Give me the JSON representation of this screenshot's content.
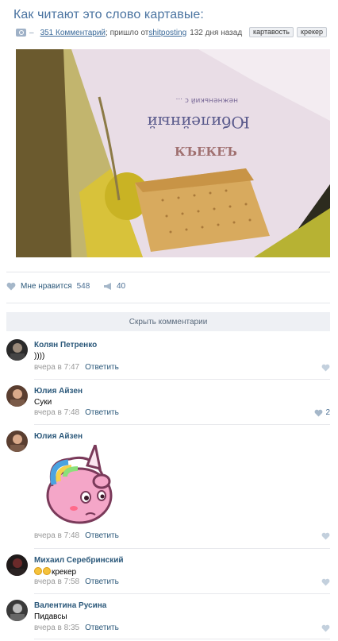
{
  "post": {
    "title": "Как читают это слово картавые:",
    "comments_link": "351 Комментарий",
    "source_prefix": "; пришло от ",
    "source": "shitposting",
    "time_ago": "132 дня назад",
    "tags": [
      "картавость",
      "крекер"
    ]
  },
  "photo": {
    "package_text": "КЪЕКЕЪ",
    "package_script": "Юбилейный",
    "package_sub": "нежненький с ..."
  },
  "actions": {
    "like_label": "Мне нравится",
    "like_count": "548",
    "repost_count": "40"
  },
  "hide_comments": "Скрыть комментарии",
  "reply_label": "Ответить",
  "comments": [
    {
      "author": "Колян Петренко",
      "text": "))))",
      "time": "вчера в 7:47",
      "likes": ""
    },
    {
      "author": "Юлия Айзен",
      "text": "Суки",
      "time": "вчера в 7:48",
      "likes": "2"
    },
    {
      "author": "Юлия Айзен",
      "text": "",
      "time": "вчера в 7:48",
      "likes": "",
      "sticker": "unicorn-sticker"
    },
    {
      "author": "Михаил Серебринский",
      "text": "крекер",
      "time": "вчера в 7:58",
      "likes": ""
    },
    {
      "author": "Валентина Русина",
      "text": "Пидавсы",
      "time": "вчера в 8:35",
      "likes": ""
    }
  ],
  "colors": {
    "link": "#2b587a",
    "title": "#4a73a0",
    "like": "#a5b7c9"
  }
}
